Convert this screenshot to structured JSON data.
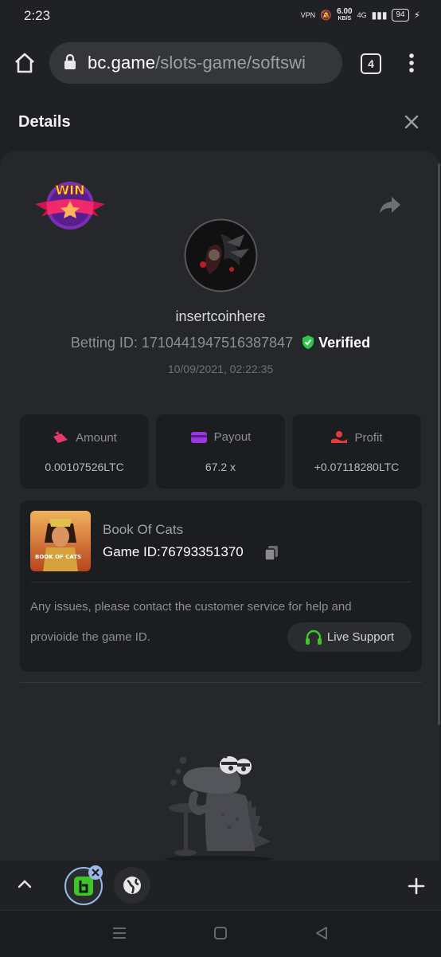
{
  "status_bar": {
    "time": "2:23",
    "net_speed": "6.00",
    "net_unit": "KB/S",
    "signal": "4G",
    "battery": "94"
  },
  "browser": {
    "url_host": "bc.game",
    "url_path": "/slots-game/softswi",
    "tab_count": "4"
  },
  "details": {
    "title": "Details",
    "badge_text": "WIN",
    "username": "insertcoinhere",
    "betting_prefix": "Betting ID: ",
    "betting_id": "1710441947516387847",
    "verified_label": "Verified",
    "datetime": "10/09/2021, 02:22:35",
    "stats": [
      {
        "label": "Amount",
        "value": "0.00107526LTC"
      },
      {
        "label": "Payout",
        "value": "67.2 x"
      },
      {
        "label": "Profit",
        "value": "+0.07118280LTC"
      }
    ],
    "game": {
      "name": "Book Of Cats",
      "id_label": "Game ID:",
      "id": "76793351370",
      "thumb_text": "BOOK OF CATS"
    },
    "notice_line1": "Any issues, please contact the customer service for help and",
    "notice_line2": "provioide the game ID.",
    "support_label": "Live Support"
  },
  "colors": {
    "bg": "#1f2023",
    "panel": "#25272b",
    "card": "#1c1d20",
    "verified": "#2cc94a",
    "support_icon": "#3ec62b"
  }
}
